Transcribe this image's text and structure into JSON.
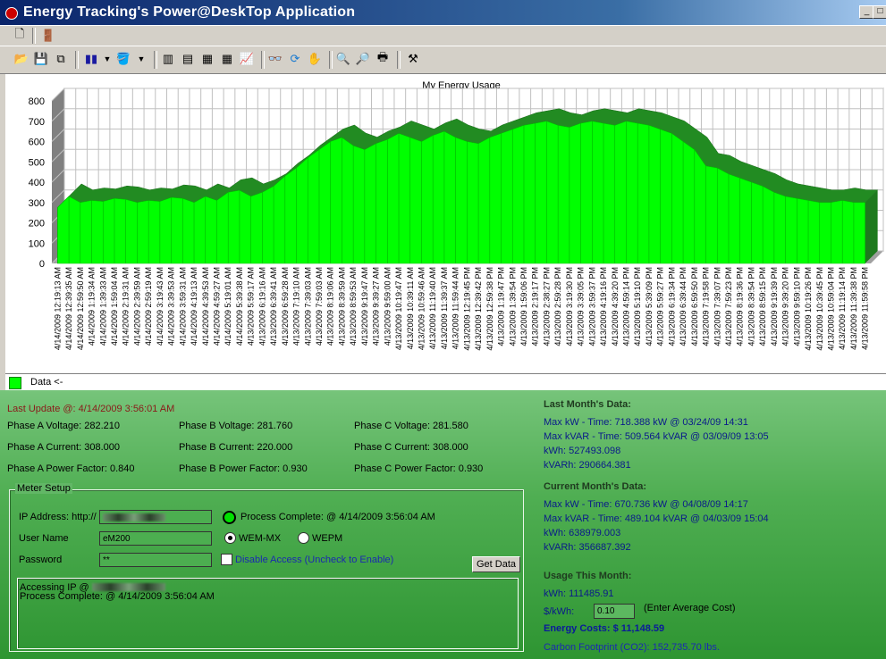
{
  "window": {
    "title": "Energy Tracking's Power@DeskTop Application"
  },
  "chart_data": {
    "type": "area",
    "title": "My Energy Usage",
    "ylim": [
      0,
      800
    ],
    "yticks": [
      0,
      100,
      200,
      300,
      400,
      500,
      600,
      700,
      800
    ],
    "legend": "Data <-",
    "legend_position": "bottom-left",
    "grid": true,
    "x_tick_labels": [
      "4/14/2009 12:19:13 AM",
      "4/14/2009 12:39:35 AM",
      "4/14/2009 12:59:50 AM",
      "4/14/2009 1:19:34 AM",
      "4/14/2009 1:39:33 AM",
      "4/14/2009 1:59:04 AM",
      "4/14/2009 2:19:31 AM",
      "4/14/2009 2:39:59 AM",
      "4/14/2009 2:59:19 AM",
      "4/14/2009 3:19:43 AM",
      "4/14/2009 3:39:53 AM",
      "4/14/2009 3:59:31 AM",
      "4/14/2009 4:19:13 AM",
      "4/14/2009 4:39:53 AM",
      "4/14/2009 4:59:27 AM",
      "4/14/2009 5:19:01 AM",
      "4/14/2009 5:39:38 AM",
      "4/13/2009 5:59:17 AM",
      "4/13/2009 6:19:16 AM",
      "4/13/2009 6:39:41 AM",
      "4/13/2009 6:59:28 AM",
      "4/13/2009 7:19:10 AM",
      "4/13/2009 7:39:03 AM",
      "4/13/2009 7:59:03 AM",
      "4/13/2009 8:19:06 AM",
      "4/13/2009 8:39:59 AM",
      "4/13/2009 8:59:53 AM",
      "4/13/2009 9:19:47 AM",
      "4/13/2009 9:39:27 AM",
      "4/13/2009 9:59:00 AM",
      "4/13/2009 10:19:47 AM",
      "4/13/2009 10:39:11 AM",
      "4/13/2009 10:59:46 AM",
      "4/13/2009 11:19:40 AM",
      "4/13/2009 11:39:37 AM",
      "4/13/2009 11:59:44 AM",
      "4/13/2009 12:19:45 PM",
      "4/13/2009 12:39:42 PM",
      "4/13/2009 12:59:38 PM",
      "4/13/2009 1:19:47 PM",
      "4/13/2009 1:39:54 PM",
      "4/13/2009 1:59:06 PM",
      "4/13/2009 2:19:17 PM",
      "4/13/2009 2:38:27 PM",
      "4/13/2009 2:59:28 PM",
      "4/13/2009 3:19:30 PM",
      "4/13/2009 3:39:05 PM",
      "4/13/2009 3:59:37 PM",
      "4/13/2009 4:19:16 PM",
      "4/13/2009 4:39:20 PM",
      "4/13/2009 4:59:14 PM",
      "4/13/2009 5:19:10 PM",
      "4/13/2009 5:39:09 PM",
      "4/13/2009 5:59:27 PM",
      "4/13/2009 6:19:34 PM",
      "4/13/2009 6:39:44 PM",
      "4/13/2009 6:59:50 PM",
      "4/13/2009 7:19:58 PM",
      "4/13/2009 7:39:07 PM",
      "4/13/2009 7:59:23 PM",
      "4/13/2009 8:19:36 PM",
      "4/13/2009 8:39:54 PM",
      "4/13/2009 8:59:15 PM",
      "4/13/2009 9:19:39 PM",
      "4/13/2009 9:39:20 PM",
      "4/13/2009 9:59:10 PM",
      "4/13/2009 10:19:26 PM",
      "4/13/2009 10:39:45 PM",
      "4/13/2009 10:59:04 PM",
      "4/13/2009 11:19:14 PM",
      "4/13/2009 11:39:38 PM",
      "4/13/2009 11:59:58 PM"
    ],
    "series": [
      {
        "values": [
          275,
          330,
          300,
          310,
          305,
          320,
          315,
          300,
          310,
          305,
          325,
          320,
          300,
          330,
          310,
          350,
          360,
          330,
          350,
          380,
          430,
          470,
          520,
          560,
          600,
          620,
          580,
          560,
          590,
          610,
          640,
          620,
          600,
          630,
          650,
          620,
          600,
          590,
          620,
          640,
          660,
          680,
          690,
          700,
          680,
          670,
          690,
          700,
          690,
          680,
          700,
          690,
          680,
          660,
          640,
          600,
          560,
          480,
          470,
          440,
          420,
          400,
          380,
          350,
          330,
          320,
          310,
          300,
          300,
          310,
          300,
          300
        ]
      }
    ]
  },
  "readings": {
    "last_update": "Last Update @: 4/14/2009 3:56:01 AM",
    "phase_a_voltage": "Phase A Voltage: 282.210",
    "phase_b_voltage": "Phase B Voltage: 281.760",
    "phase_c_voltage": "Phase C Voltage: 281.580",
    "phase_a_current": "Phase A Current: 308.000",
    "phase_b_current": "Phase B Current: 220.000",
    "phase_c_current": "Phase C Current: 308.000",
    "phase_a_pf": "Phase A Power Factor: 0.840",
    "phase_b_pf": "Phase B Power Factor: 0.930",
    "phase_c_pf": "Phase C Power Factor: 0.930"
  },
  "meter_setup": {
    "title": "Meter Setup",
    "ip_label": "IP Address: http://",
    "user_label": "User Name",
    "user_value": "eM200",
    "password_label": "Password",
    "password_value": "**",
    "status": "Process Complete: @ 4/14/2009 3:56:04 AM",
    "radio_wem_mx": "WEM-MX",
    "radio_wepm": "WEPM",
    "disable_access": "Disable Access (Uncheck to Enable)",
    "get_data": "Get Data",
    "log_line1": "Accessing IP @",
    "log_line2": "Process Complete: @ 4/14/2009 3:56:04 AM"
  },
  "last_month": {
    "title": "Last Month's Data:",
    "max_kw": "Max kW - Time: 718.388 kW @ 03/24/09 14:31",
    "max_kvar": "Max kVAR - Time: 509.564 kVAR @ 03/09/09 13:05",
    "kwh": "kWh: 527493.098",
    "kvarh": "kVARh: 290664.381"
  },
  "current_month": {
    "title": "Current Month's Data:",
    "max_kw": "Max kW - Time: 670.736 kW @ 04/08/09 14:17",
    "max_kvar": "Max kVAR - Time: 489.104 kVAR @ 04/03/09 15:04",
    "kwh": "kWh: 638979.003",
    "kvarh": "kVARh: 356687.392"
  },
  "usage": {
    "title": "Usage This Month:",
    "kwh": "kWh: 111485.91",
    "cost_label": "$/kWh:",
    "cost_value": "0.10",
    "cost_hint": "(Enter Average Cost)",
    "energy_costs": "Energy Costs: $ 11,148.59",
    "carbon": "Carbon Footprint (CO2): 152,735.70 lbs."
  }
}
